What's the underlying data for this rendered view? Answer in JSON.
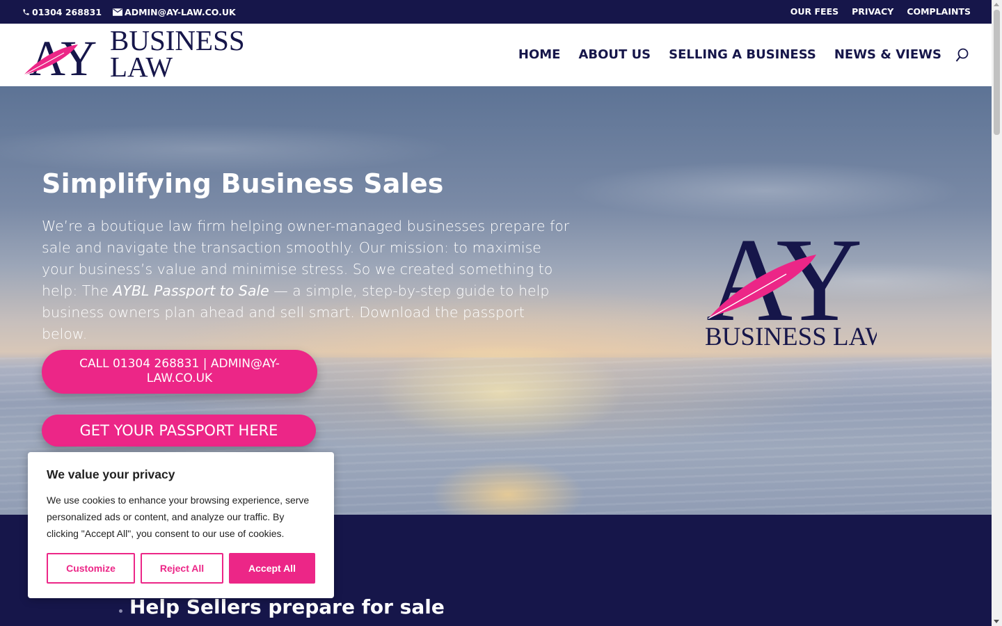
{
  "topbar": {
    "phone": "01304 268831",
    "email": "ADMIN@AY-LAW.CO.UK",
    "links": [
      "OUR FEES",
      "PRIVACY",
      "COMPLAINTS"
    ]
  },
  "header": {
    "logo_line1": "BUSINESS",
    "logo_line2": "LAW",
    "logo_mark": "AY",
    "nav": [
      "HOME",
      "ABOUT US",
      "SELLING A BUSINESS",
      "NEWS & VIEWS"
    ],
    "search_icon": "search-icon"
  },
  "hero": {
    "title": "Simplifying Business Sales",
    "text_part1": "We’re a boutique law firm helping owner-managed businesses prepare for sale and navigate the transaction smoothly. Our mission: to maximise your business’s value and minimise stress. So we created something to help: The ",
    "text_em": "AYBL Passport to Sale",
    "text_part2": " — a simple, step-by-step guide to help business owners plan ahead and sell smart. Download the passport below.",
    "call_button": "CALL 01304 268831 | ADMIN@AY-LAW.CO.UK",
    "passport_button": "GET YOUR PASSPORT HERE",
    "logo_mark": "AY",
    "logo_text": "BUSINESS LAW"
  },
  "section": {
    "heading": "Help Sellers prepare for sale"
  },
  "cookie": {
    "title": "We value your privacy",
    "text": "We use cookies to enhance your browsing experience, serve personalized ads or content, and analyze our traffic. By clicking \"Accept All\", you consent to our use of cookies.",
    "customize": "Customize",
    "reject": "Reject All",
    "accept": "Accept All"
  },
  "colors": {
    "navy": "#16164a",
    "pink": "#ec2687"
  }
}
